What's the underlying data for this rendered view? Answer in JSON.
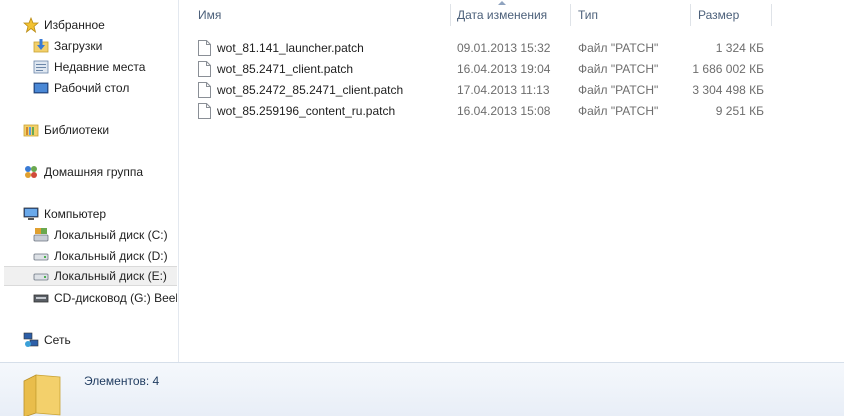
{
  "nav": {
    "favorites": "Избранное",
    "downloads": "Загрузки",
    "recent": "Недавние места",
    "desktop": "Рабочий стол",
    "libraries": "Библиотеки",
    "homegroup": "Домашняя группа",
    "computer": "Компьютер",
    "disk_c": "Локальный диск (C:)",
    "disk_d": "Локальный диск (D:)",
    "disk_e": "Локальный диск (E:)",
    "cd": "CD-дисковод (G:) Beeli",
    "network": "Сеть"
  },
  "columns": {
    "name": "Имя",
    "date": "Дата изменения",
    "type": "Тип",
    "size": "Размер"
  },
  "files": [
    {
      "name": "wot_81.141_launcher.patch",
      "date": "09.01.2013 15:32",
      "type": "Файл \"PATCH\"",
      "size": "1 324 КБ"
    },
    {
      "name": "wot_85.2471_client.patch",
      "date": "16.04.2013 19:04",
      "type": "Файл \"PATCH\"",
      "size": "1 686 002 КБ"
    },
    {
      "name": "wot_85.2472_85.2471_client.patch",
      "date": "17.04.2013 11:13",
      "type": "Файл \"PATCH\"",
      "size": "3 304 498 КБ"
    },
    {
      "name": "wot_85.259196_content_ru.patch",
      "date": "16.04.2013 15:08",
      "type": "Файл \"PATCH\"",
      "size": "9 251 КБ"
    }
  ],
  "details": {
    "count": "Элементов: 4"
  },
  "colors": {
    "header_text": "#4c607a",
    "details_bg": "#e8eef7",
    "folder_yellow": "#f3d06b"
  }
}
